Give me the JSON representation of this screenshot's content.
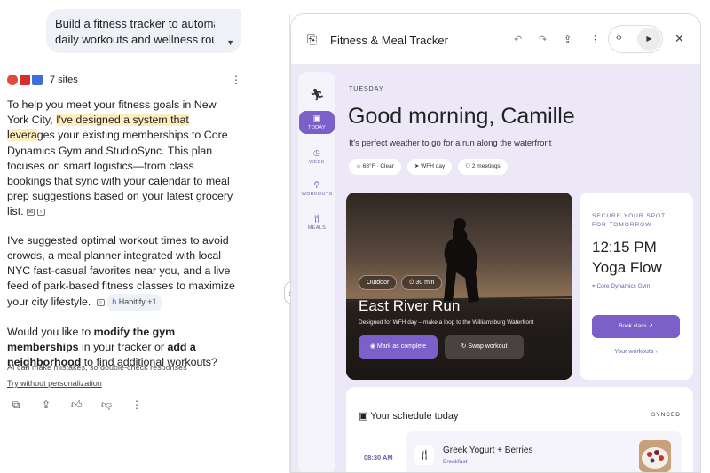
{
  "chat": {
    "prompt_line1": "Build a fitness tracker to automate",
    "prompt_line2": "daily workouts and wellness routin...",
    "sources_count": "7 sites",
    "paragraph1_a": "To help you meet your fitness goals in New York City, ",
    "paragraph1_hl": "I've designed a system that levera",
    "paragraph1_b": "ges your existing memberships to Core Dynamics Gym and StudioSync. This plan focuses on smart logistics—from class bookings that sync with your calendar to meal prep suggestions based on your latest grocery list.",
    "paragraph2": "I've suggested optimal workout times to avoid crowds, a meal planner integrated with local NYC fast-casual favorites near you, and a live feed of park-based fitness classes to maximize your city lifestyle.",
    "paragraph2_chip": "Habitify +1",
    "paragraph3_a": "Would you like to ",
    "paragraph3_bold1": "modify the gym memberships",
    "paragraph3_b": " in your tracker or ",
    "paragraph3_bold2": "add a neighborhood",
    "paragraph3_c": " to find additional workouts?",
    "disclaimer": "AI can make mistakes, so double-check responses",
    "try_link": "Try without personalization"
  },
  "app": {
    "title": "Fitness & Meal Tracker",
    "rail": {
      "today": "TODAY",
      "week": "WEEK",
      "workouts": "WORKOUTS",
      "meals": "MEALS"
    },
    "day": "TUESDAY",
    "greeting": "Good morning, Camille",
    "subtitle": "It's perfect weather to go for a run along the waterfront",
    "pills": [
      "68°F · Clear",
      "WFH day",
      "2 meetings"
    ],
    "hero": {
      "tag1": "Outdoor",
      "tag2": "30 min",
      "title": "East River Run",
      "description": "Designed for WFH day – make a loop to the Williamsburg Waterfront",
      "primary_button": "Mark as complete",
      "secondary_button": "Swap workout"
    },
    "promo": {
      "eyebrow": "SECURE YOUR SPOT FOR TOMORROW",
      "time": "12:15 PM",
      "class_name": "Yoga Flow",
      "location": "Core Dynamics Gym",
      "book_button": "Book class",
      "link": "Your workouts"
    },
    "schedule": {
      "title": "Your schedule today",
      "status": "SYNCED",
      "items": [
        {
          "time": "08:30 AM",
          "name": "Greek Yogurt + Berries",
          "type": "Breakfast"
        }
      ]
    }
  },
  "colors": {
    "accent": "#7d5fc9",
    "canvas_bg": "#ece8f8",
    "highlight": "#fdeec0"
  }
}
